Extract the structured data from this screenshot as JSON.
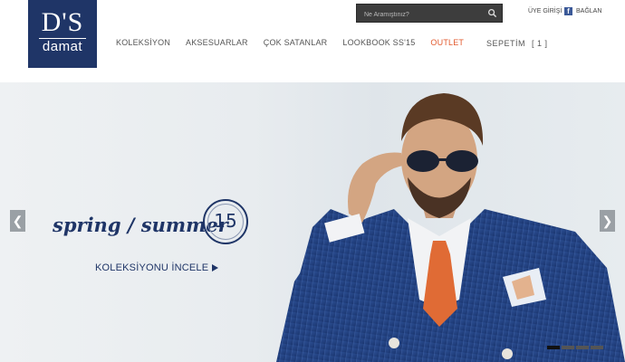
{
  "logo": {
    "top": "D'S",
    "bottom": "damat"
  },
  "nav": [
    {
      "label": "KOLEKSİYON"
    },
    {
      "label": "AKSESUARLAR"
    },
    {
      "label": "ÇOK SATANLAR"
    },
    {
      "label": "LOOKBOOK SS'15"
    },
    {
      "label": "OUTLET"
    }
  ],
  "search": {
    "placeholder": "Ne Aramıştınız?",
    "icon": "search-icon"
  },
  "login_label": "ÜYE GİRİŞİ",
  "facebook": {
    "label": "BAĞLAN",
    "icon": "facebook-icon"
  },
  "cart": {
    "label": "SEPETİM",
    "count": "[ 1 ]"
  },
  "hero": {
    "headline": "spring / summer",
    "number": "15",
    "cta": "KOLEKSİYONU İNCELE",
    "slides": 4,
    "active_slide": 1
  },
  "colors": {
    "brand": "#1f3567",
    "outlet": "#e2592d",
    "search_bg": "#3d3d3d"
  }
}
